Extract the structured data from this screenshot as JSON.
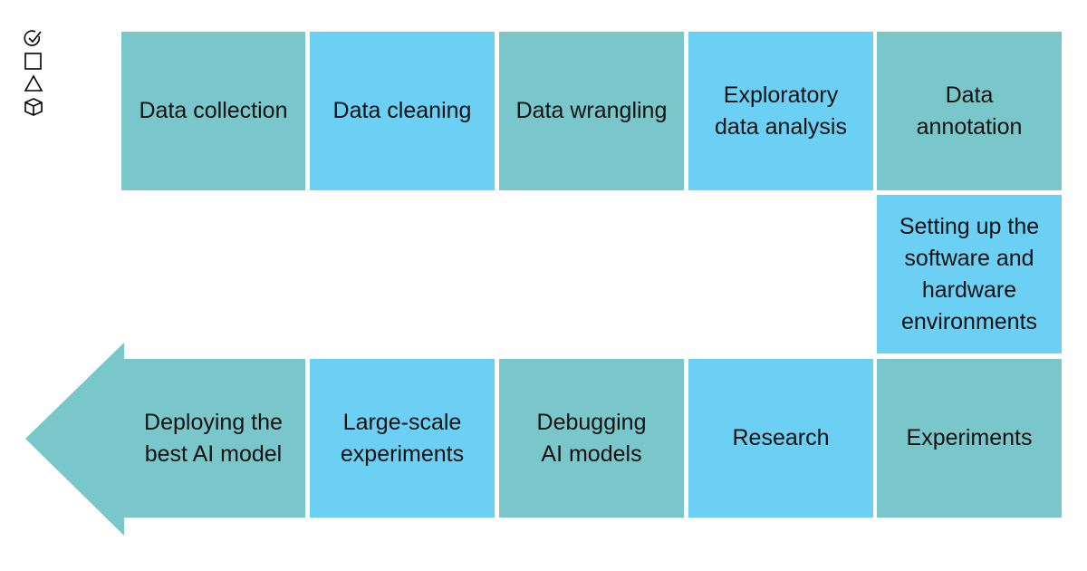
{
  "colors": {
    "teal": "#79c7ca",
    "blue": "#6bd0f3"
  },
  "icons": [
    "check-circle-icon",
    "square-icon",
    "triangle-icon",
    "cube-icon"
  ],
  "row1": [
    "Data collection",
    "Data cleaning",
    "Data wrangling",
    "Exploratory data analysis",
    "Data annotation"
  ],
  "row2": [
    "Setting up the software and hardware environments"
  ],
  "row3": [
    "Deploying the best AI model",
    "Large-scale experiments",
    "Debugging AI models",
    "Research",
    "Experiments"
  ]
}
